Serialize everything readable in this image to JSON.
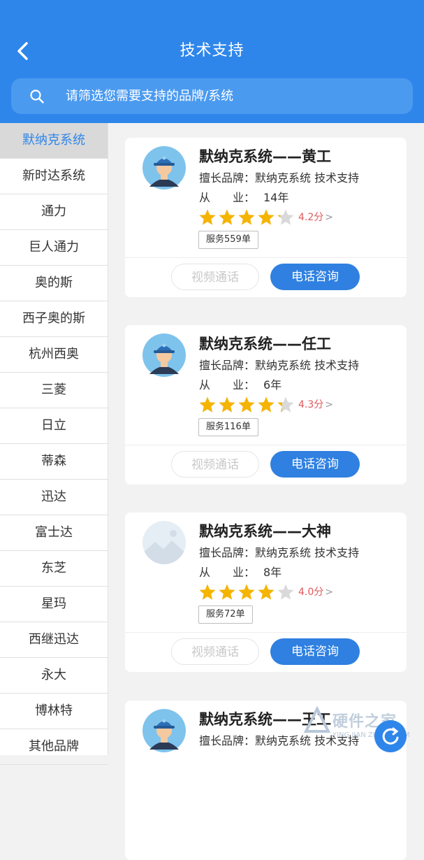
{
  "header": {
    "title": "技术支持",
    "back_icon": "chevron-left-icon",
    "background": "#2f86ea"
  },
  "search": {
    "placeholder": "请筛选您需要支持的品牌/系统",
    "icon": "search-icon"
  },
  "sidebar": {
    "active_color": "#2f86ea",
    "items": [
      {
        "label": "默纳克系统",
        "active": true
      },
      {
        "label": "新时达系统"
      },
      {
        "label": "通力"
      },
      {
        "label": "巨人通力"
      },
      {
        "label": "奥的斯"
      },
      {
        "label": "西子奥的斯"
      },
      {
        "label": "杭州西奥"
      },
      {
        "label": "三菱"
      },
      {
        "label": "日立"
      },
      {
        "label": "蒂森"
      },
      {
        "label": "迅达"
      },
      {
        "label": "富士达"
      },
      {
        "label": "东芝"
      },
      {
        "label": "星玛"
      },
      {
        "label": "西继迅达"
      },
      {
        "label": "永大"
      },
      {
        "label": "博林特"
      },
      {
        "label": "其他品牌"
      }
    ]
  },
  "experts": [
    {
      "name": "默纳克系统——黄工",
      "brand_label": "擅长品牌：",
      "brand_value": "默纳克系统 技术支持",
      "years_label": "从　　业：",
      "years_value": "14年",
      "rating": 4.2,
      "rating_text": "4.2分",
      "orders": "服务559单",
      "avatar": "technician-avatar-icon",
      "video_label": "视频通话",
      "phone_label": "电话咨询"
    },
    {
      "name": "默纳克系统——任工",
      "brand_label": "擅长品牌：",
      "brand_value": "默纳克系统 技术支持",
      "years_label": "从　　业：",
      "years_value": "6年",
      "rating": 4.3,
      "rating_text": "4.3分",
      "orders": "服务116单",
      "avatar": "technician-avatar-icon",
      "video_label": "视频通话",
      "phone_label": "电话咨询"
    },
    {
      "name": "默纳克系统——大神",
      "brand_label": "擅长品牌：",
      "brand_value": "默纳克系统 技术支持",
      "years_label": "从　　业：",
      "years_value": "8年",
      "rating": 4.0,
      "rating_text": "4.0分",
      "orders": "服务72单",
      "avatar": "image-placeholder-icon",
      "video_label": "视频通话",
      "phone_label": "电话咨询"
    },
    {
      "name": "默纳克系统——王工",
      "brand_label": "擅长品牌：",
      "brand_value": "默纳克系统 技术支持",
      "avatar": "technician-avatar-icon"
    }
  ],
  "watermark": {
    "text": "硬件之家",
    "sub": "YING JIAN ZHI JIA.COM"
  },
  "colors": {
    "star_filled": "#f5b400",
    "star_empty": "#d9d9d9",
    "rating_text": "#e0575a",
    "primary_button": "#2f80e0"
  }
}
